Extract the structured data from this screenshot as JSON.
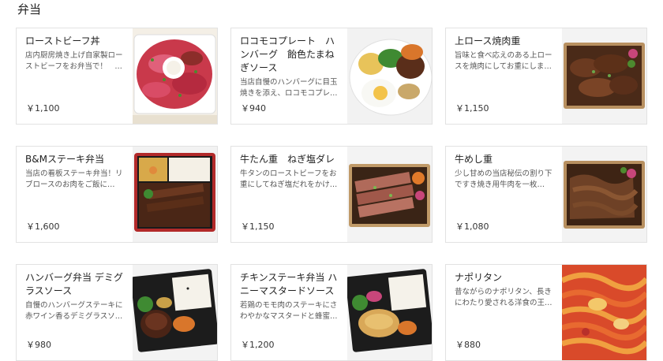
{
  "section": {
    "title": "弁当"
  },
  "items": [
    {
      "name": "ローストビーフ丼",
      "desc": "店内厨房焼き上げ自家製ローストビーフをお弁当で！　…",
      "price": "￥1,100",
      "photo": "roast-beef-bowl-photo"
    },
    {
      "name": "ロコモコプレート　ハンバーグ　飴色たまねぎソース",
      "desc": "当店自慢のハンバーグに目玉焼きを添え、ロコモコプレ…",
      "price": "￥940",
      "photo": "loco-moco-plate-photo"
    },
    {
      "name": "上ロース焼肉重",
      "desc": "旨味と食べ応えのある上ロースを焼肉にしてお重にしま…",
      "price": "￥1,150",
      "photo": "loin-yakiniku-box-photo"
    },
    {
      "name": "B&Mステーキ弁当",
      "desc": "当店の看板ステーキ弁当！リブロースのお肉をご飯に…",
      "price": "￥1,600",
      "photo": "steak-bento-photo"
    },
    {
      "name": "牛たん重　ねぎ塩ダレ",
      "desc": "牛タンのローストビーフをお重にしてねぎ塩だれをかけ…",
      "price": "￥1,150",
      "photo": "beef-tongue-box-photo"
    },
    {
      "name": "牛めし重",
      "desc": "少し甘めの当店秘伝の割り下ですき焼き用牛肉を一枚…",
      "price": "￥1,080",
      "photo": "gyumeshi-box-photo"
    },
    {
      "name": "ハンバーグ弁当 デミグラスソース",
      "desc": "自慢のハンバーグステーキに赤ワイン香るデミグラスソ…",
      "price": "￥980",
      "photo": "hamburg-bento-photo"
    },
    {
      "name": "チキンステーキ弁当 ハニーマスタードソース",
      "desc": "若鶏のモモ肉のステーキにさわやかなマスタードと蜂蜜…",
      "price": "￥1,200",
      "photo": "chicken-steak-bento-photo"
    },
    {
      "name": "ナポリタン",
      "desc": "昔ながらのナポリタン、長きにわたり愛される洋食の王…",
      "price": "￥880",
      "photo": "napolitan-photo"
    }
  ]
}
